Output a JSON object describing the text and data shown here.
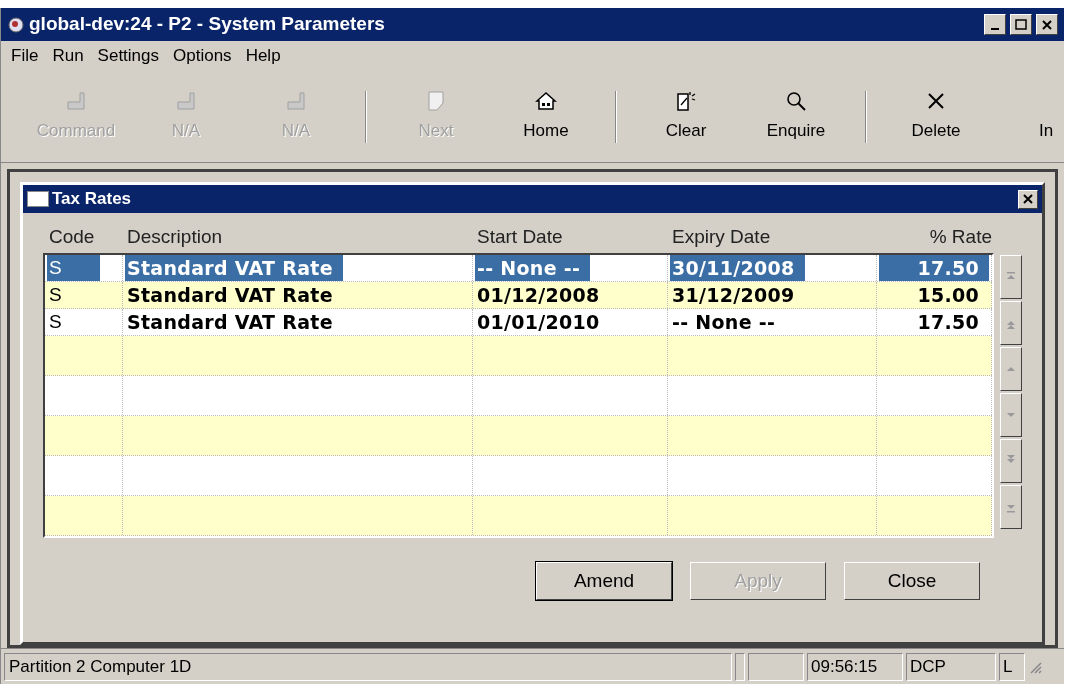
{
  "window": {
    "title": "global-dev:24 - P2 - System Parameters"
  },
  "menu": [
    "File",
    "Run",
    "Settings",
    "Options",
    "Help"
  ],
  "toolbar": [
    {
      "label": "Command",
      "kind": "f1",
      "disabled": true,
      "separator_after": false
    },
    {
      "label": "N/A",
      "kind": "f2",
      "disabled": true,
      "separator_after": false
    },
    {
      "label": "N/A",
      "kind": "f3",
      "disabled": true,
      "separator_after": true
    },
    {
      "label": "Next",
      "kind": "page",
      "disabled": true,
      "separator_after": false
    },
    {
      "label": "Home",
      "kind": "house",
      "disabled": false,
      "separator_after": true
    },
    {
      "label": "Clear",
      "kind": "clear",
      "disabled": false,
      "separator_after": false
    },
    {
      "label": "Enquire",
      "kind": "search",
      "disabled": false,
      "separator_after": true
    },
    {
      "label": "Delete",
      "kind": "cross",
      "disabled": false,
      "separator_after": false
    },
    {
      "label": "In",
      "kind": "none",
      "disabled": false,
      "separator_after": false
    }
  ],
  "dialog": {
    "title": "Tax Rates",
    "columns": [
      "Code",
      "Description",
      "Start Date",
      "Expiry Date",
      "% Rate"
    ],
    "rows": [
      {
        "cells": [
          "S",
          "Standard VAT Rate",
          "-- None --",
          "30/11/2008",
          "17.50"
        ],
        "selected": true
      },
      {
        "cells": [
          "S",
          "Standard VAT Rate",
          "01/12/2008",
          "31/12/2009",
          "15.00"
        ],
        "selected": false
      },
      {
        "cells": [
          "S",
          "Standard VAT Rate",
          "01/01/2010",
          "-- None --",
          "17.50"
        ],
        "selected": false
      }
    ],
    "buttons": [
      {
        "label": "Amend",
        "disabled": false,
        "default": true
      },
      {
        "label": "Apply",
        "disabled": true,
        "default": false
      },
      {
        "label": "Close",
        "disabled": false,
        "default": false
      }
    ]
  },
  "status_bar": {
    "message": "Partition 2 Computer 1D",
    "time": "09:56:15",
    "user": "DCP",
    "mode": "L"
  }
}
